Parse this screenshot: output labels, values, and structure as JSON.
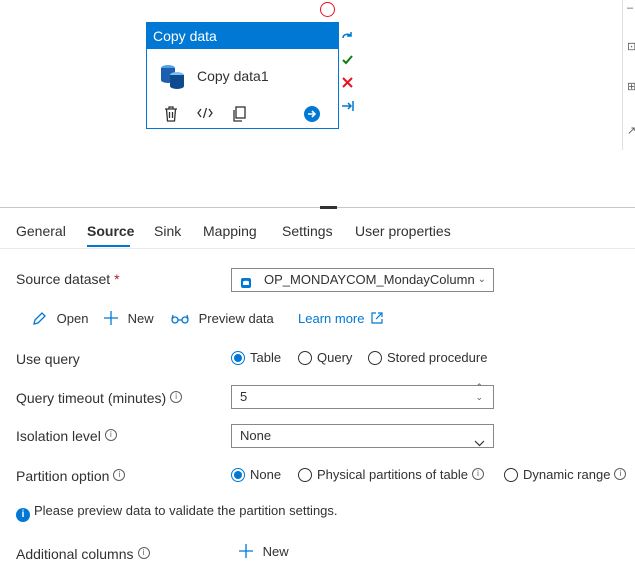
{
  "activity": {
    "header": "Copy data",
    "name": "Copy data1"
  },
  "tabs": [
    "General",
    "Source",
    "Sink",
    "Mapping",
    "Settings",
    "User properties"
  ],
  "source_dataset": {
    "label": "Source dataset",
    "required_mark": "*",
    "value": "OP_MONDAYCOM_MondayColumn"
  },
  "actions": {
    "open": "Open",
    "new": "New",
    "preview": "Preview data",
    "learn_more": "Learn more"
  },
  "use_query": {
    "label": "Use query",
    "options": [
      "Table",
      "Query",
      "Stored procedure"
    ],
    "selected": "Table"
  },
  "query_timeout": {
    "label": "Query timeout (minutes)",
    "value": "5"
  },
  "isolation_level": {
    "label": "Isolation level",
    "value": "None"
  },
  "partition_option": {
    "label": "Partition option",
    "options": [
      "None",
      "Physical partitions of table",
      "Dynamic range"
    ],
    "selected": "None"
  },
  "partition_note": "Please preview data to validate the partition settings.",
  "additional_columns": {
    "label": "Additional columns",
    "new": "New"
  },
  "colors": {
    "accent": "#0078d4",
    "error": "#e81123",
    "success": "#107c10"
  }
}
